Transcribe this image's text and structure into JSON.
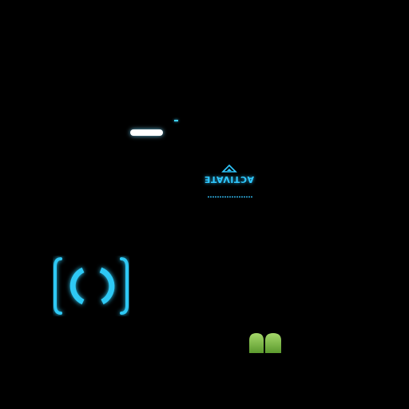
{
  "hud": {
    "activate_label": "ACTIVATE",
    "activate_caption": "",
    "accent_color": "#2fc8ff",
    "bar_color": "#ffffff",
    "pickup_color": "#7fc24a"
  },
  "icons": {
    "activate_arrow": "triangle-up-icon",
    "reticle": "reload-reticle-icon",
    "pickup": "green-pickup-icon"
  }
}
